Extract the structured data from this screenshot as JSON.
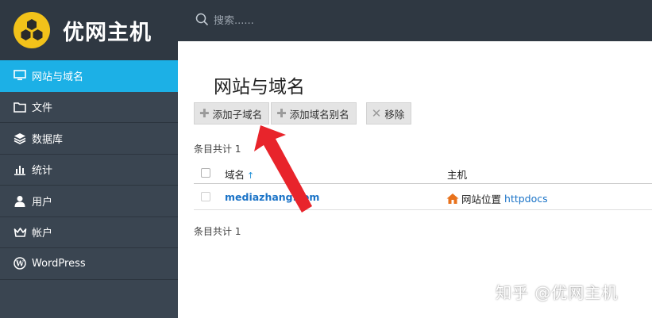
{
  "app": {
    "name": "优网主机",
    "logo_icon": "hexagon-cluster-icon",
    "logo_color": "#f2c21a"
  },
  "sidebar": {
    "items": [
      {
        "label": "网站与域名",
        "icon": "monitor-icon",
        "active": true
      },
      {
        "label": "文件",
        "icon": "folder-icon",
        "active": false
      },
      {
        "label": "数据库",
        "icon": "database-stack-icon",
        "active": false
      },
      {
        "label": "统计",
        "icon": "bar-chart-icon",
        "active": false
      },
      {
        "label": "用户",
        "icon": "user-icon",
        "active": false
      },
      {
        "label": "帐户",
        "icon": "crown-icon",
        "active": false
      },
      {
        "label": "WordPress",
        "icon": "wordpress-icon",
        "active": false
      }
    ]
  },
  "search": {
    "placeholder": "搜索......"
  },
  "main": {
    "title": "网站与域名",
    "toolbar": {
      "add_subdomain": "添加子域名",
      "add_alias": "添加域名别名",
      "remove": "移除"
    },
    "count_label": "条目共计 1",
    "table": {
      "columns": {
        "domain": "域名",
        "host": "主机"
      },
      "sort_indicator": "↑",
      "rows": [
        {
          "domain": "mediazhang.com",
          "host_label": "网站位置",
          "host_link": "httpdocs"
        }
      ]
    }
  },
  "watermark": "知乎 @优网主机",
  "colors": {
    "accent": "#1cb0e6",
    "sidebar_bg": "#3a4551",
    "topbar_bg": "#2f3842",
    "link": "#1a73c7",
    "arrow": "#e8242b"
  }
}
